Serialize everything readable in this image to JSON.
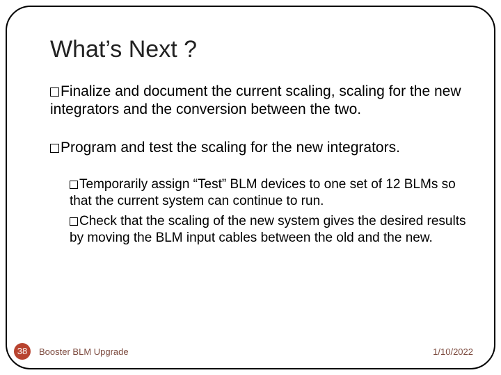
{
  "title": "What’s Next ?",
  "bullets": [
    {
      "level": 1,
      "text": "Finalize and document the current scaling, scaling for the new integrators and the conversion between the two."
    },
    {
      "level": 1,
      "text": "Program and test the scaling for the new integrators."
    },
    {
      "level": 2,
      "text": "Temporarily assign “Test” BLM devices to one set of 12 BLMs so that the current system can continue to run."
    },
    {
      "level": 2,
      "text": "Check that the scaling of the new system gives the desired results by moving the BLM input cables between the old and the new."
    }
  ],
  "page_number": "38",
  "footer_left": "Booster BLM Upgrade",
  "footer_right": "1/10/2022"
}
